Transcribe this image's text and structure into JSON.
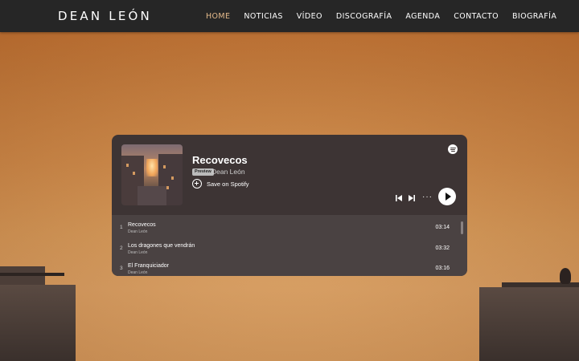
{
  "header": {
    "logo": "DEAN LEÓN",
    "nav": [
      {
        "label": "HOME",
        "active": true
      },
      {
        "label": "NOTICIAS",
        "active": false
      },
      {
        "label": "VÍDEO",
        "active": false
      },
      {
        "label": "DISCOGRAFÍA",
        "active": false
      },
      {
        "label": "AGENDA",
        "active": false
      },
      {
        "label": "CONTACTO",
        "active": false
      },
      {
        "label": "BIOGRAFÍA",
        "active": false
      }
    ]
  },
  "player": {
    "title": "Recovecos",
    "preview_badge": "Preview",
    "artist": "Dean León",
    "save_label": "Save on Spotify",
    "tracks": [
      {
        "number": "1",
        "name": "Recovecos",
        "artist": "Dean León",
        "duration": "03:14"
      },
      {
        "number": "2",
        "name": "Los dragones que vendrán",
        "artist": "Dean León",
        "duration": "03:32"
      },
      {
        "number": "3",
        "name": "El Franquiciador",
        "artist": "Dean León",
        "duration": "03:16"
      }
    ]
  },
  "colors": {
    "header_bg": "#262626",
    "nav_active": "#e3b98a",
    "player_bg": "#3d3434",
    "tracklist_bg": "#4a4242",
    "page_bg": "#cc8a4a"
  },
  "icons": [
    "spotify-logo-icon",
    "plus-circle-icon",
    "previous-track-icon",
    "next-track-icon",
    "more-options-icon",
    "play-icon"
  ]
}
